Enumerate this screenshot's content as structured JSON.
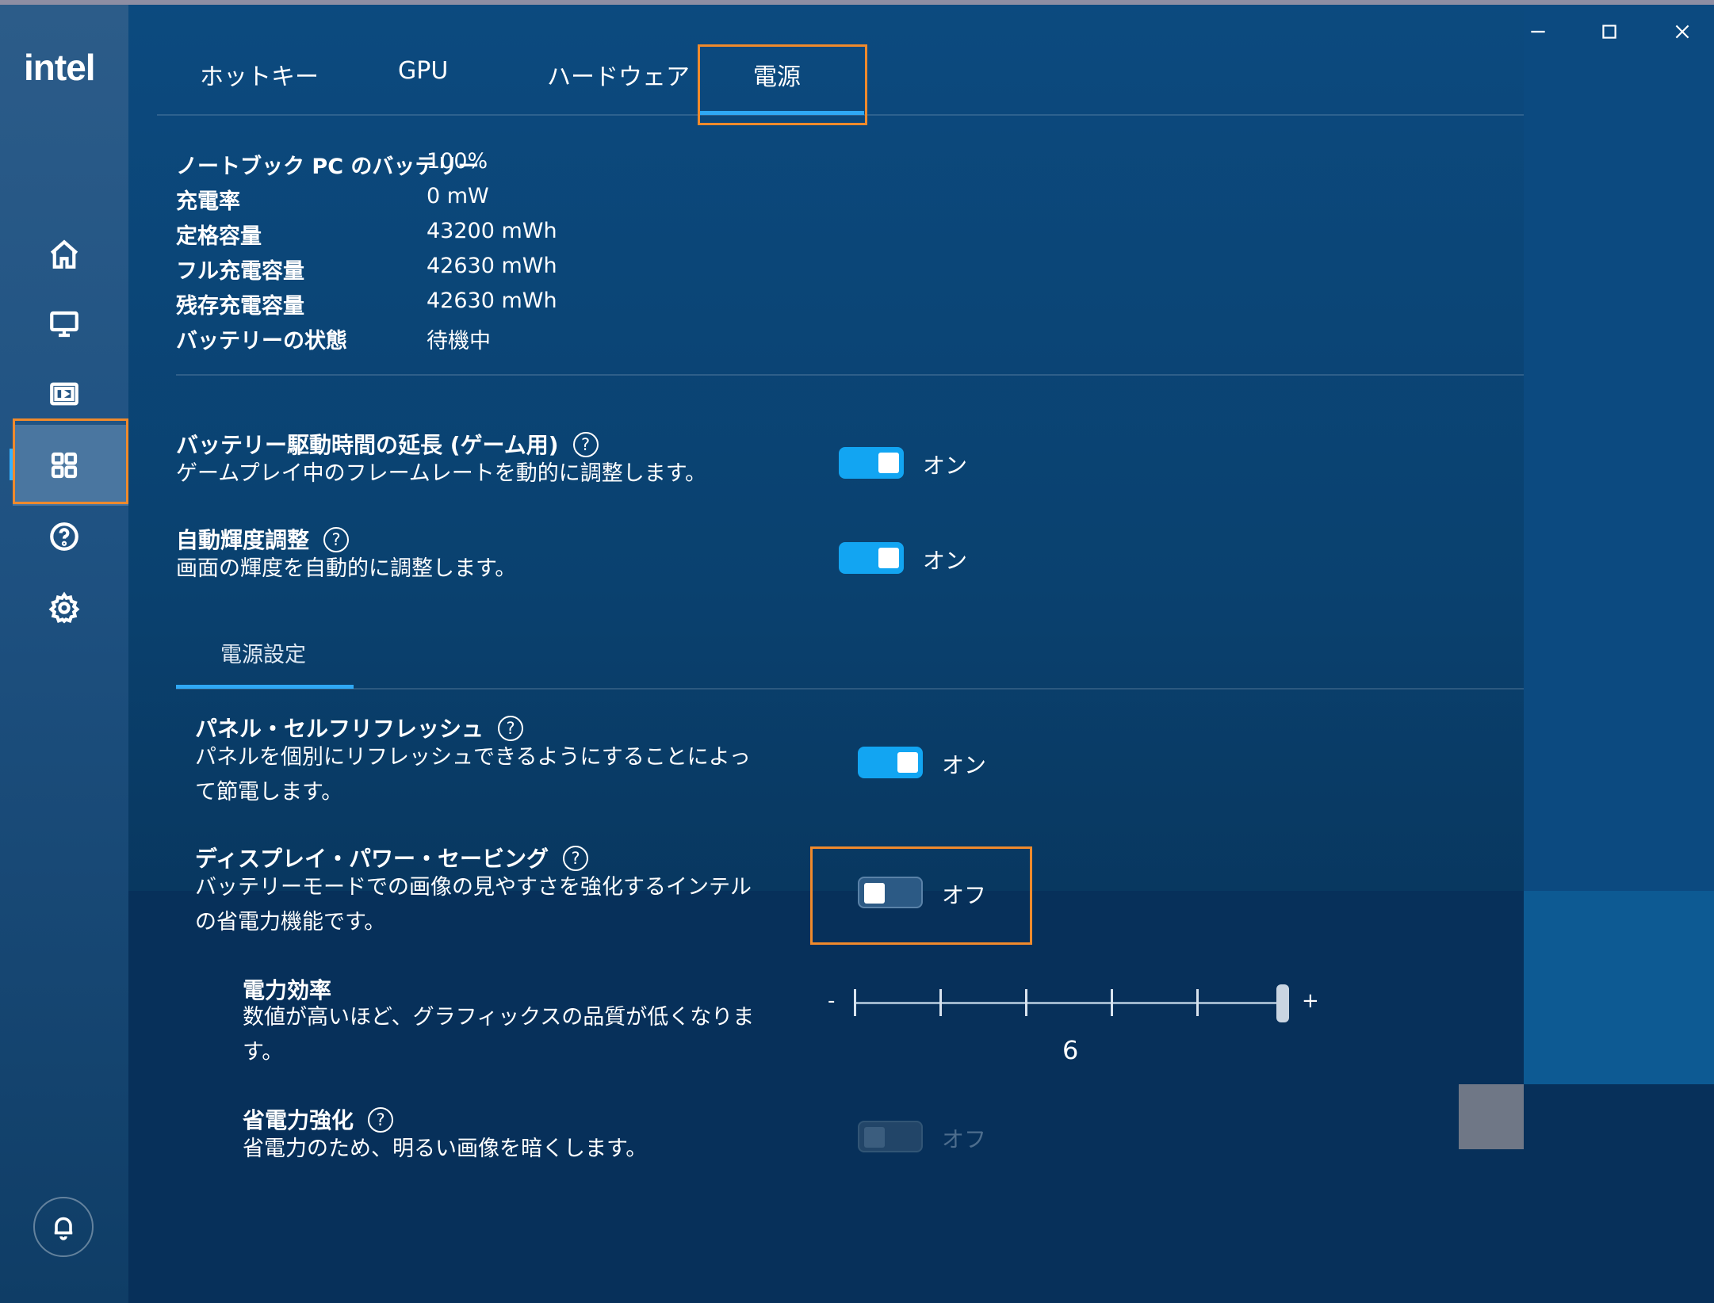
{
  "app": {
    "logo_text": "intel"
  },
  "tabs": [
    {
      "label": "ホットキー"
    },
    {
      "label": "GPU"
    },
    {
      "label": "ハードウェア"
    },
    {
      "label": "電源",
      "active": true
    }
  ],
  "sidebar": {
    "items": [
      {
        "icon": "home-icon"
      },
      {
        "icon": "monitor-icon"
      },
      {
        "icon": "media-icon"
      },
      {
        "icon": "apps-grid-icon",
        "active": true
      },
      {
        "icon": "help-icon"
      },
      {
        "icon": "gear-icon"
      }
    ],
    "notification_icon": "bell-icon"
  },
  "battery_info": [
    {
      "label": "ノートブック PC のバッテリー",
      "value": "100%"
    },
    {
      "label": "充電率",
      "value": "0 mW"
    },
    {
      "label": "定格容量",
      "value": "43200 mWh"
    },
    {
      "label": "フル充電容量",
      "value": "42630 mWh"
    },
    {
      "label": "残存充電容量",
      "value": "42630 mWh"
    },
    {
      "label": "バッテリーの状態",
      "value": "待機中"
    }
  ],
  "settings": {
    "battery_extend": {
      "title": "バッテリー駆動時間の延長 (ゲーム用)",
      "desc": "ゲームプレイ中のフレームレートを動的に調整します。",
      "state": "オン"
    },
    "auto_brightness": {
      "title": "自動輝度調整",
      "desc": "画面の輝度を自動的に調整します。",
      "state": "オン"
    }
  },
  "power_settings": {
    "subtab_label": "電源設定",
    "panel_self_refresh": {
      "title": "パネル・セルフリフレッシュ",
      "desc_line1": "パネルを個別にリフレッシュできるようにすることによっ",
      "desc_line2": "て節電します。",
      "state": "オン"
    },
    "display_power_saving": {
      "title": "ディスプレイ・パワー・セービング",
      "desc_line1": "バッテリーモードでの画像の見やすさを強化するインテル",
      "desc_line2": "の省電力機能です。",
      "state": "オフ"
    },
    "power_efficiency": {
      "title": "電力効率",
      "desc_line1": "数値が高いほど、グラフィックスの品質が低くなりま",
      "desc_line2": "す。",
      "slider_min_label": "-",
      "slider_max_label": "+",
      "slider_value": "6",
      "slider_steps": 6,
      "slider_level": 6
    },
    "enhanced_power_saving": {
      "title": "省電力強化",
      "desc": "省電力のため、明るい画像を暗くします。",
      "state": "オフ"
    }
  },
  "colors": {
    "accent": "#2fa8f5",
    "toggle_on": "#12a5f2",
    "highlight": "#f08a2c",
    "background": "#0a416f"
  }
}
